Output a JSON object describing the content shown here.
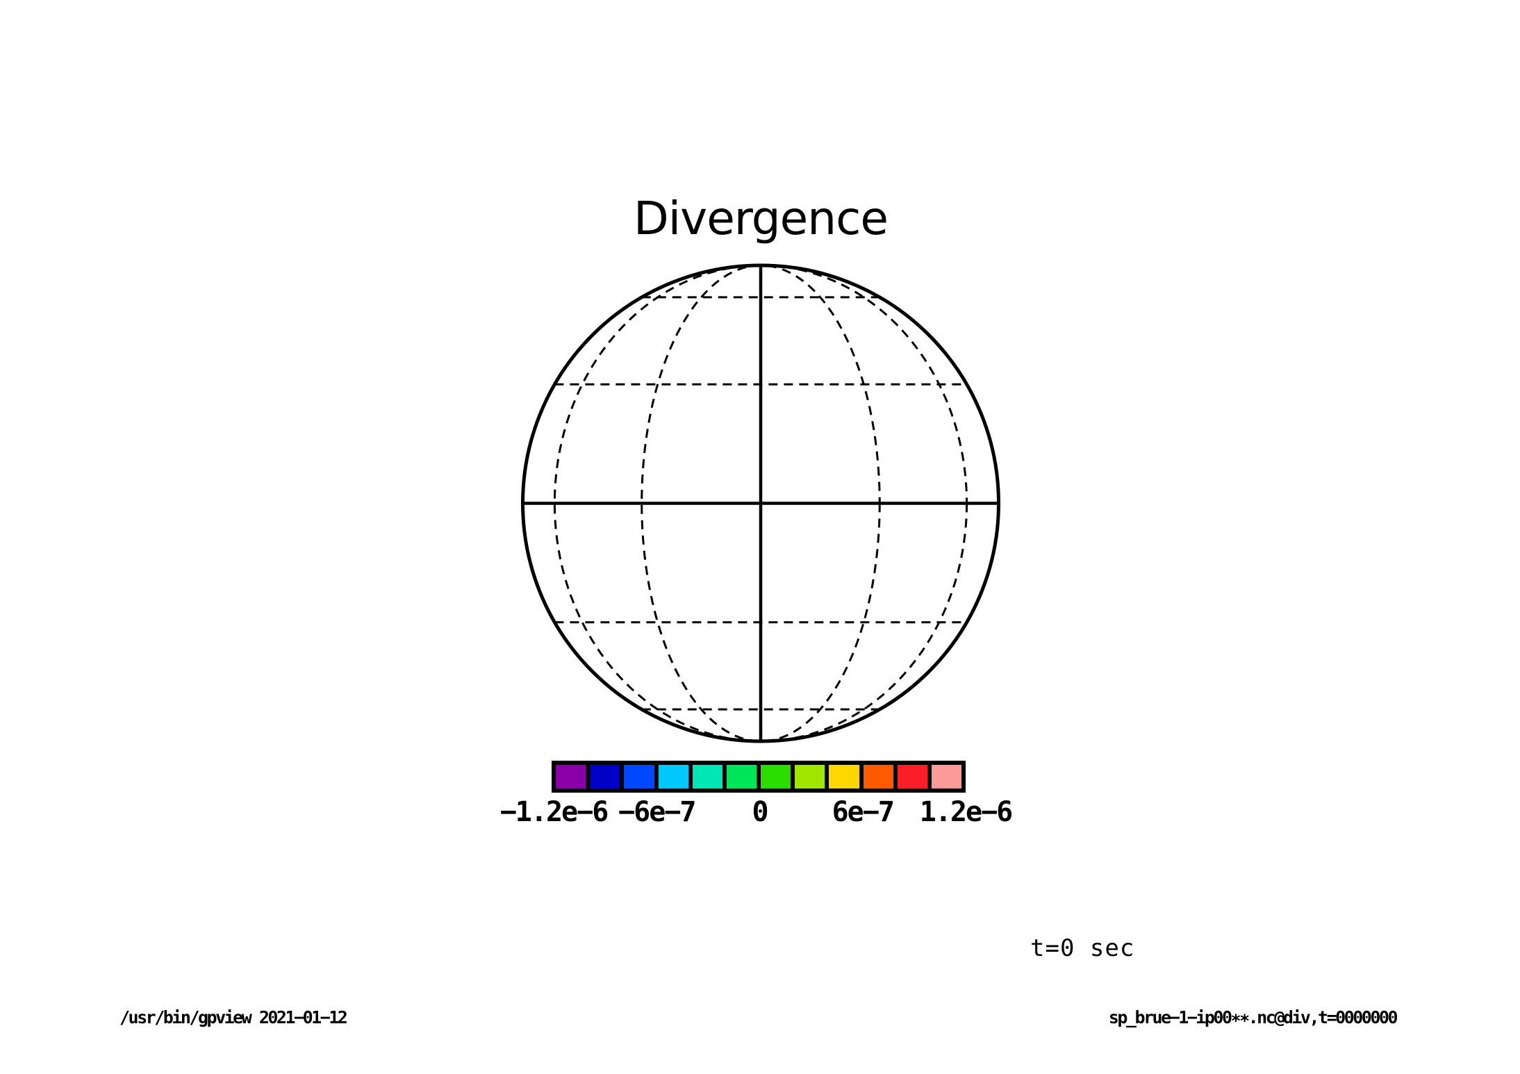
{
  "title": "Divergence",
  "time_label": "t=0 sec",
  "footer": {
    "left": "/usr/bin/gpview  2021−01−12",
    "right": "sp_brue−1−ip00∗∗.nc@div,t=0000000"
  },
  "colorbar": {
    "tick_labels": [
      "−1.2e−6",
      "−6e−7",
      "0",
      "6e−7",
      "1.2e−6"
    ],
    "colors": [
      "#8A00A8",
      "#0000C8",
      "#0048FF",
      "#00C8FA",
      "#00E6B4",
      "#00E65A",
      "#2BDC00",
      "#A0E600",
      "#FFD700",
      "#FF5A00",
      "#FA1E28",
      "#FC9A9A"
    ]
  },
  "chart_data": {
    "type": "map",
    "projection": "orthographic-equatorial",
    "title": "Divergence",
    "field": "divergence",
    "time": "t=0 sec",
    "shading_visible": false,
    "graticule": {
      "lon_interval_deg": 30,
      "lat_interval_deg": 30,
      "dashed_lines": "meridians ±30°, ±60° and parallels ±30°, ±60°",
      "solid_lines": "limb circle, equator, central meridian"
    },
    "colorbar": {
      "n_cells": 12,
      "cell_interval": 2e-07,
      "min": -1.2e-06,
      "max": 1.2e-06,
      "tick_values": [
        -1.2e-06,
        -6e-07,
        0,
        6e-07,
        1.2e-06
      ],
      "tick_labels": [
        "−1.2e−6",
        "−6e−7",
        "0",
        "6e−7",
        "1.2e−6"
      ],
      "colors": [
        "#8A00A8",
        "#0000C8",
        "#0048FF",
        "#00C8FA",
        "#00E6B4",
        "#00E65A",
        "#2BDC00",
        "#A0E600",
        "#FFD700",
        "#FF5A00",
        "#FA1E28",
        "#FC9A9A"
      ],
      "legend_position": "bottom"
    }
  }
}
